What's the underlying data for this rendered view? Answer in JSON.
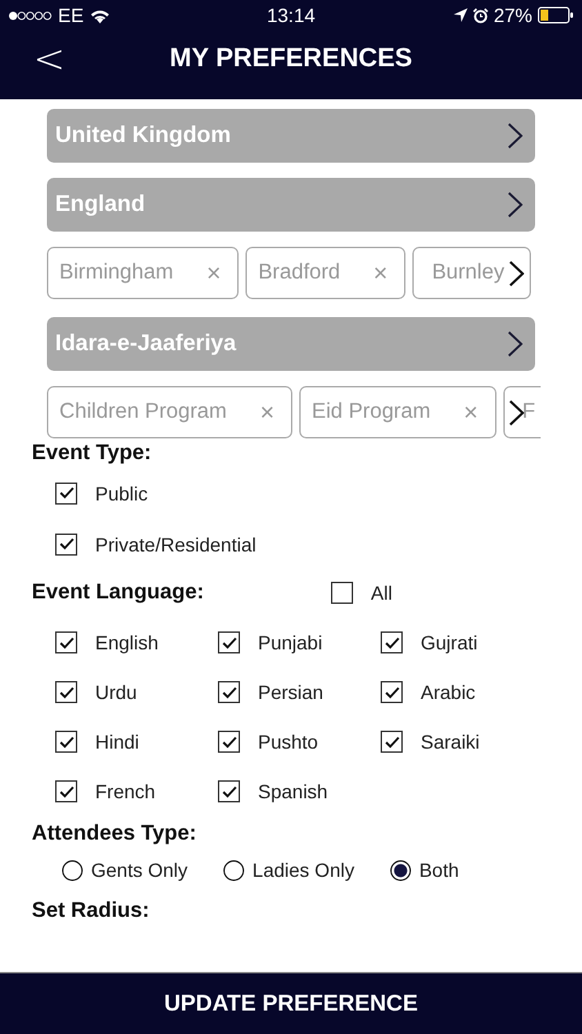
{
  "status_bar": {
    "carrier": "EE",
    "time": "13:14",
    "battery": "27%"
  },
  "nav": {
    "back": "<",
    "title": "MY PREFERENCES"
  },
  "selectors": [
    {
      "kind": "select",
      "label": "United Kingdom"
    },
    {
      "kind": "select",
      "label": "England"
    },
    {
      "kind": "tags",
      "tags": [
        {
          "label": "Birmingham",
          "remove": "×"
        },
        {
          "label": "Bradford",
          "remove": "×"
        },
        {
          "label": "Burnley"
        }
      ]
    },
    {
      "kind": "select",
      "label": "Idara-e-Jaaferiya"
    },
    {
      "kind": "tags",
      "tags": [
        {
          "label": "Children Program",
          "remove": "×"
        },
        {
          "label": "Eid Program",
          "remove": "×"
        },
        {
          "label": "F"
        }
      ]
    }
  ],
  "event_type": {
    "label": "Event Type:",
    "options": [
      {
        "label": "Public",
        "checked": true
      },
      {
        "label": "Private/Residential",
        "checked": true
      }
    ]
  },
  "event_language": {
    "label": "Event Language:",
    "all": {
      "label": "All",
      "checked": false
    },
    "options": [
      {
        "label": "English",
        "checked": true
      },
      {
        "label": "Punjabi",
        "checked": true
      },
      {
        "label": "Gujrati",
        "checked": true
      },
      {
        "label": "Urdu",
        "checked": true
      },
      {
        "label": "Persian",
        "checked": true
      },
      {
        "label": "Arabic",
        "checked": true
      },
      {
        "label": "Hindi",
        "checked": true
      },
      {
        "label": "Pushto",
        "checked": true
      },
      {
        "label": "Saraiki",
        "checked": true
      },
      {
        "label": "French",
        "checked": true
      },
      {
        "label": "Spanish",
        "checked": true
      }
    ]
  },
  "attendees_type": {
    "label": "Attendees Type:",
    "options": [
      {
        "label": "Gents Only",
        "selected": false
      },
      {
        "label": "Ladies Only",
        "selected": false
      },
      {
        "label": "Both",
        "selected": true
      }
    ]
  },
  "radius": {
    "label": "Set Radius:"
  },
  "update_button": "UPDATE PREFERENCE"
}
